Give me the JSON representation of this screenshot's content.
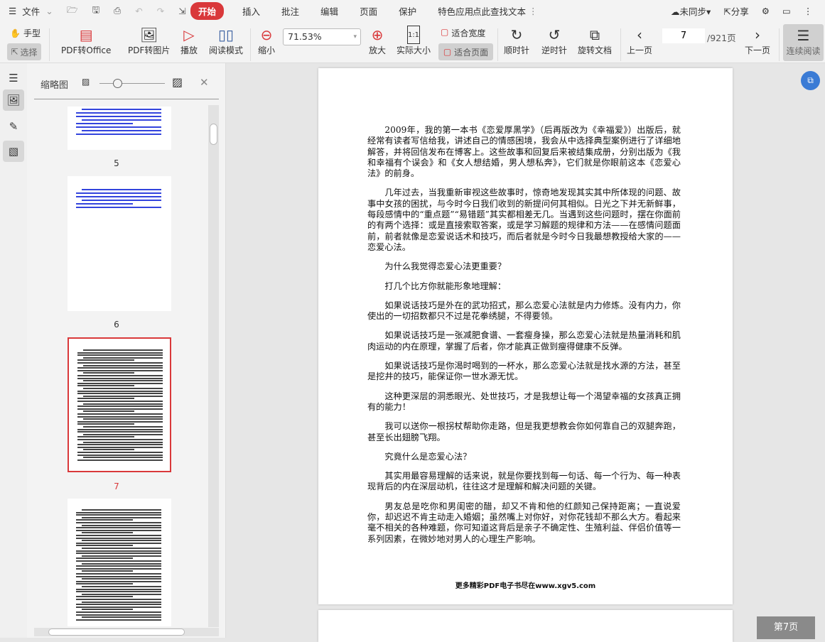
{
  "menu": {
    "file": "文件",
    "tabs": [
      "开始",
      "插入",
      "批注",
      "编辑",
      "页面",
      "保护",
      "特色应用"
    ],
    "search": "点此查找文本",
    "sync": "未同步",
    "share": "分享"
  },
  "toolbar": {
    "hand": "手型",
    "select": "选择",
    "pdf_office": "PDF转Office",
    "pdf_image": "PDF转图片",
    "play": "播放",
    "read_mode": "阅读模式",
    "zoom_out": "缩小",
    "zoom_value": "71.53%",
    "zoom_in": "放大",
    "actual_size": "实际大小",
    "fit_width": "适合宽度",
    "fit_page": "适合页面",
    "clockwise": "顺时针",
    "counter": "逆时针",
    "rotate_doc": "旋转文档",
    "prev": "上一页",
    "page_num": "7",
    "page_total": "/921页",
    "next": "下一页",
    "continuous": "连续阅读"
  },
  "sidebar": {
    "title": "缩略图",
    "thumbs": [
      "5",
      "6",
      "7"
    ]
  },
  "document": {
    "paragraphs": [
      "2009年，我的第一本书《恋爱厚黑学》（后再版改为《幸福爱》）出版后，就经常有读者写信给我，讲述自己的情感困境，我会从中选择典型案例进行了详细地解答，并将回信发布在博客上。这些故事和回复后来被结集成册，分别出版为《我和幸福有个误会》和《女人想结婚，男人想私奔》，它们就是你眼前这本《恋爱心法》的前身。",
      "几年过去，当我重新审视这些故事时，惊奇地发现其实其中所体现的问题、故事中女孩的困扰，与今时今日我们收到的新提问何其相似。日光之下并无新鲜事，每段感情中的“重点题”“易错题”其实都相差无几。当遇到这些问题时，摆在你面前的有两个选择：或是直接索取答案，或是学习解题的规律和方法——在感情问题面前，前者就像是恋爱说话术和技巧，而后者就是今时今日我最想教授给大家的——恋爱心法。",
      "为什么我觉得恋爱心法更重要？",
      "打几个比方你就能形象地理解：",
      "如果说话技巧是外在的武功招式，那么恋爱心法就是内力修炼。没有内力，你使出的一切招数都只不过是花拳绣腿，不得要领。",
      "如果说话技巧是一张减肥食谱、一套瘦身操，那么恋爱心法就是热量消耗和肌肉运动的内在原理，掌握了后者，你才能真正做到瘦得健康不反弹。",
      "如果说话技巧是你渴时喝到的一杯水，那么恋爱心法就是找水源的方法，甚至是挖井的技巧，能保证你一世水源无忧。",
      "这种更深层的洞悉眼光、处世技巧，才是我想让每一个渴望幸福的女孩真正拥有的能力！",
      "我可以送你一根拐杖帮助你走路，但是我更想教会你如何靠自己的双腿奔跑，甚至长出翅膀飞翔。",
      "究竟什么是恋爱心法？",
      "其实用最容易理解的话来说，就是你要找到每一句话、每一个行为、每一种表现背后的内在深层动机，往往这才是理解和解决问题的关键。",
      "男友总是吃你和男闺密的醋，却又不肯和他的红颜知己保持距离；一直说爱你，却迟迟不肯主动走入婚姻；虽然嘴上对你好，对你花钱却不那么大方。看起来毫不相关的各种难题，你可知道这背后是亲子不确定性、生殖利益、伴侣价值等一系列因素，在微妙地对男人的心理生产影响。"
    ],
    "footer": "更多精彩PDF电子书尽在www.xgv5.com"
  },
  "status": {
    "page_badge": "第7页"
  },
  "colors": {
    "accent": "#d9383a",
    "link": "#3a7bd5"
  }
}
